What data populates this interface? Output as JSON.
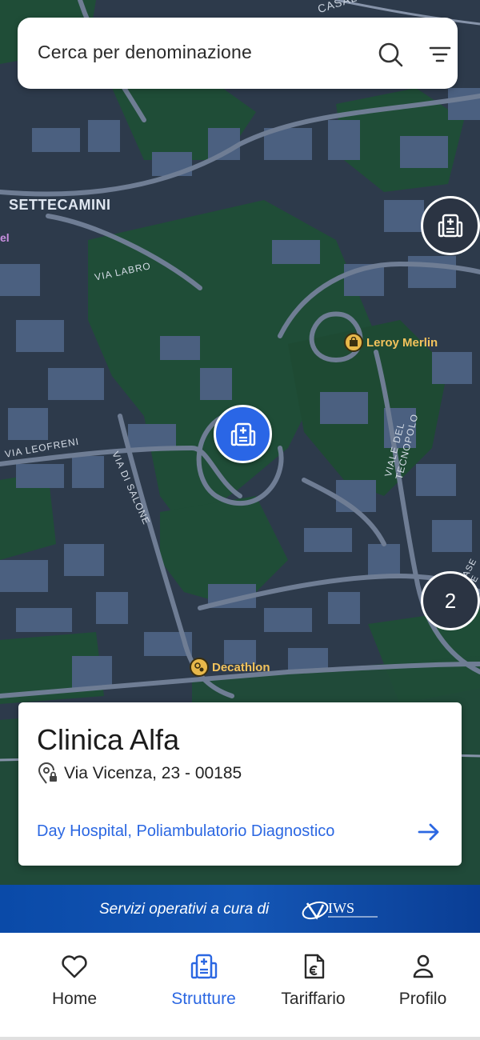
{
  "search": {
    "placeholder": "Cerca per denominazione",
    "search_icon": "search-icon",
    "filter_icon": "filter-icon"
  },
  "map": {
    "labels": {
      "casal": "CASAL BIANCO",
      "settecamini": "SETTECAMINI",
      "via_labro": "VIA LABRO",
      "via_leofreni": "VIA LEOFRENI",
      "via_di_salone": "VIA DI SALONE",
      "viale_del_tecnopolo": "VIALE DEL TECNOPOLO",
      "case_be": "CASE BE",
      "edge_el": "el"
    },
    "pois": [
      {
        "name": "Leroy Merlin",
        "icon": "shopping-bag-icon"
      },
      {
        "name": "Decathlon",
        "icon": "sports-icon"
      }
    ],
    "cluster_count": "2",
    "colors": {
      "park": "#1f4d37",
      "urban": "#2d3a4b",
      "building": "#4b6080",
      "road": "#6f7d94",
      "marker_active": "#2a66e6"
    }
  },
  "card": {
    "title": "Clinica Alfa",
    "address": "Via Vicenza, 23 - 00185",
    "types": "Day Hospital, Poliambulatorio Diagnostico",
    "accent": "#2b67e2"
  },
  "banner": {
    "text": "Servizi operativi a cura di",
    "logo_text": "IWS"
  },
  "nav": {
    "items": [
      {
        "label": "Home",
        "icon": "heart-icon"
      },
      {
        "label": "Strutture",
        "icon": "hospital-icon",
        "active": true
      },
      {
        "label": "Tariffario",
        "icon": "price-list-icon"
      },
      {
        "label": "Profilo",
        "icon": "user-icon"
      }
    ]
  }
}
